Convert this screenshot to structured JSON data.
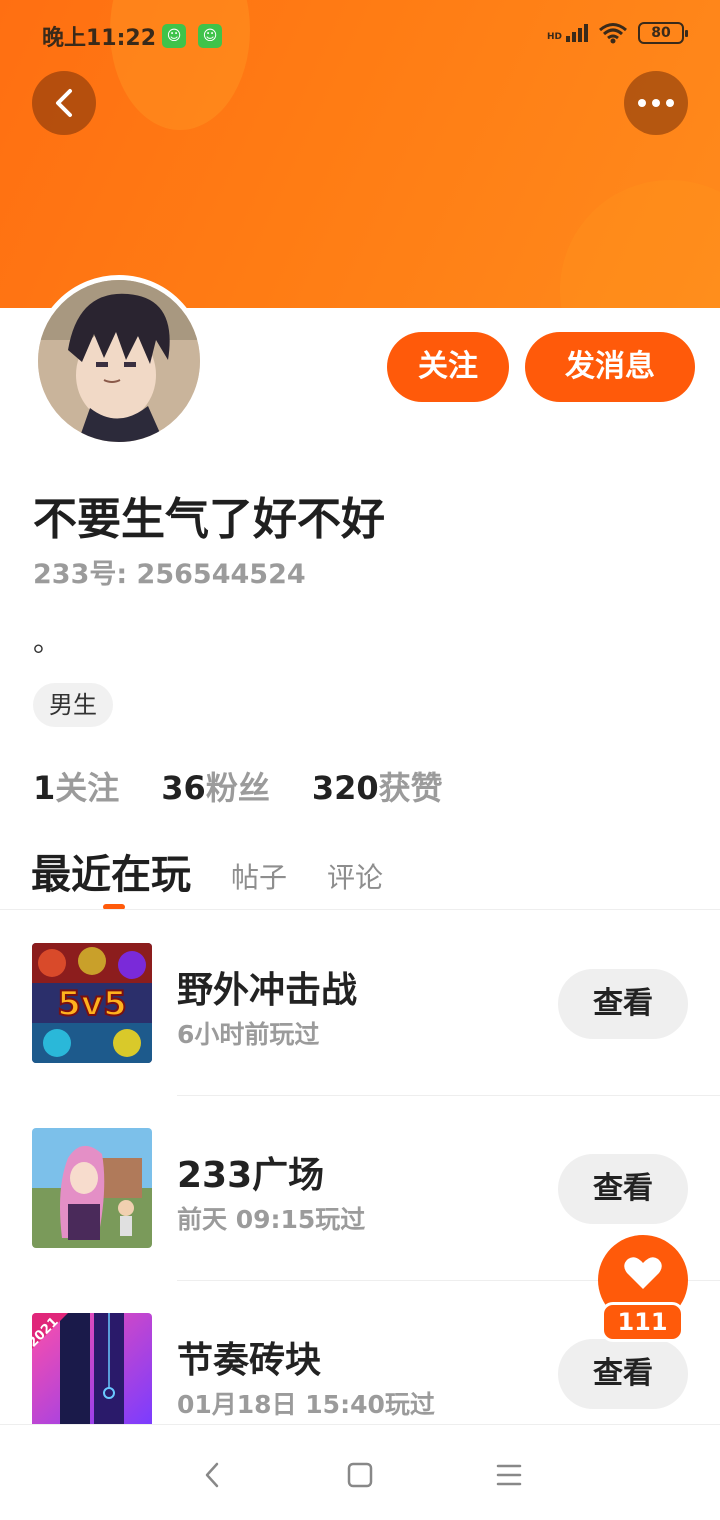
{
  "status_bar": {
    "time": "晚上11:22",
    "network": "HD",
    "battery": "80",
    "icons": [
      "app-notification-icon",
      "app-notification-icon",
      "signal-icon",
      "wifi-icon",
      "battery-icon"
    ]
  },
  "header": {
    "back_icon": "back-arrow-icon",
    "more_icon": "more-dots-icon"
  },
  "profile": {
    "avatar_icon": "avatar",
    "follow_label": "关注",
    "message_label": "发消息",
    "nickname": "不要生气了好不好",
    "uid": "233号: 256544524",
    "bio": "。",
    "gender_tag": "男生"
  },
  "stats": [
    {
      "num": "1",
      "label": "关注"
    },
    {
      "num": "36",
      "label": "粉丝"
    },
    {
      "num": "320",
      "label": "获赞"
    }
  ],
  "tabs": [
    {
      "label": "最近在玩",
      "active": true
    },
    {
      "label": "帖子",
      "active": false
    },
    {
      "label": "评论",
      "active": false
    }
  ],
  "games": [
    {
      "name": "野外冲击战",
      "time": "6小时前玩过",
      "button": "查看",
      "thumb_text": "5v5"
    },
    {
      "name": "233广场",
      "time": "前天 09:15玩过",
      "button": "查看",
      "thumb_text": ""
    },
    {
      "name": "节奏砖块",
      "time": "01月18日 15:40玩过",
      "button": "查看",
      "thumb_text": "2021"
    }
  ],
  "like_fab": {
    "icon": "heart-icon",
    "count": "111"
  },
  "nav_bar": {
    "icons": [
      "nav-back-icon",
      "nav-home-icon",
      "nav-menu-icon"
    ]
  },
  "colors": {
    "accent": "#ff5a0a",
    "header_gradient_start": "#ff6f12",
    "header_gradient_end": "#ff8a1c",
    "muted_text": "#9b9b9b",
    "chip_bg": "#f1f1f1"
  }
}
